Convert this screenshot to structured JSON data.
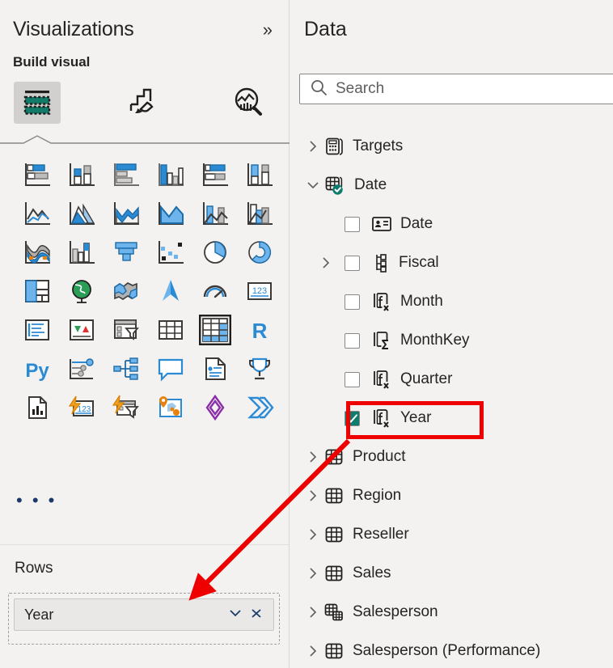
{
  "visualizations": {
    "title": "Visualizations",
    "collapse_label": "»",
    "build_visual_label": "Build visual",
    "tabs": [
      {
        "name": "fields",
        "icon": "fields-icon",
        "selected": true
      },
      {
        "name": "format",
        "icon": "paintbrush-icon",
        "selected": false
      },
      {
        "name": "analytics",
        "icon": "analytics-magnifier-icon",
        "selected": false
      }
    ],
    "icons": [
      "stacked-bar-chart-icon",
      "stacked-column-chart-icon",
      "clustered-bar-chart-icon",
      "clustered-column-chart-icon",
      "100-stacked-bar-chart-icon",
      "100-stacked-column-chart-icon",
      "line-chart-icon",
      "area-chart-icon",
      "stacked-area-chart-icon",
      "line-and-stacked-column-chart-icon",
      "line-and-clustered-column-chart-icon",
      "ribbon-chart-icon",
      "waterfall-chart-icon",
      "funnel-chart-icon",
      "scatter-chart-icon",
      "pie-chart-icon",
      "donut-chart-icon",
      "treemap-icon",
      "map-icon",
      "filled-map-icon",
      "azure-map-icon",
      "gauge-icon",
      "card-icon",
      "multi-row-card-icon",
      "kpi-icon",
      "slicer-icon",
      "table-icon",
      "matrix-icon",
      "r-script-visual-icon",
      "python-visual-icon",
      "key-influencers-icon",
      "decomposition-tree-icon",
      "qna-icon",
      "smart-narrative-icon",
      "metrics-icon",
      "paginated-report-icon",
      "power-apps-icon",
      "power-automate-icon",
      "arcgis-maps-icon",
      "power-bi-visual-icon",
      "flow-visual-icon"
    ],
    "selected_icon": "matrix-icon",
    "more_label": "• • •",
    "wells": {
      "rows_label": "Rows",
      "chip": {
        "label": "Year",
        "dropdown_icon": "chevron-down-icon",
        "remove_icon": "close-icon"
      }
    }
  },
  "data": {
    "title": "Data",
    "search": {
      "placeholder": "Search",
      "icon": "search-icon",
      "value": ""
    },
    "tree": [
      {
        "label": "Targets",
        "type": "table",
        "icon": "calculation-group-icon",
        "indent": "table",
        "expanded": false,
        "chevron": "chevron-right"
      },
      {
        "label": "Date",
        "type": "table",
        "icon": "date-table-icon",
        "indent": "table",
        "expanded": true,
        "chevron": "chevron-down",
        "badge": "date-table-check-badge"
      },
      {
        "label": "Date",
        "type": "field",
        "icon": "date-field-icon",
        "indent": "field",
        "checked": false
      },
      {
        "label": "Fiscal",
        "type": "hierarchy",
        "icon": "hierarchy-icon",
        "indent": "field-chev",
        "checked": false,
        "chevron": "chevron-right"
      },
      {
        "label": "Month",
        "type": "field",
        "icon": "calculated-column-icon",
        "indent": "field",
        "checked": false
      },
      {
        "label": "MonthKey",
        "type": "field",
        "icon": "summarized-column-icon",
        "indent": "field",
        "checked": false
      },
      {
        "label": "Quarter",
        "type": "field",
        "icon": "calculated-column-icon",
        "indent": "field",
        "checked": false
      },
      {
        "label": "Year",
        "type": "field",
        "icon": "calculated-column-icon",
        "indent": "field",
        "checked": true,
        "highlighted": true
      },
      {
        "label": "Product",
        "type": "table",
        "icon": "table-icon",
        "indent": "table",
        "expanded": false,
        "chevron": "chevron-right"
      },
      {
        "label": "Region",
        "type": "table",
        "icon": "table-icon",
        "indent": "table",
        "expanded": false,
        "chevron": "chevron-right"
      },
      {
        "label": "Reseller",
        "type": "table",
        "icon": "table-icon",
        "indent": "table",
        "expanded": false,
        "chevron": "chevron-right"
      },
      {
        "label": "Sales",
        "type": "table",
        "icon": "table-icon",
        "indent": "table",
        "expanded": false,
        "chevron": "chevron-right"
      },
      {
        "label": "Salesperson",
        "type": "table",
        "icon": "multi-table-icon",
        "indent": "table",
        "expanded": false,
        "chevron": "chevron-right"
      },
      {
        "label": "Salesperson (Performance)",
        "type": "table",
        "icon": "table-icon",
        "indent": "table",
        "expanded": false,
        "chevron": "chevron-right"
      }
    ]
  },
  "annotation": {
    "highlight_color": "#ee0000",
    "highlight_target": "Year",
    "arrow_from": "year-field-row",
    "arrow_to": "rows-well-chip"
  },
  "colors": {
    "pane_background": "#f3f2f1",
    "accent_teal": "#0f7b6c",
    "accent_blue": "#2a8ad4",
    "annotation_red": "#ee0000",
    "text": "#252423"
  }
}
